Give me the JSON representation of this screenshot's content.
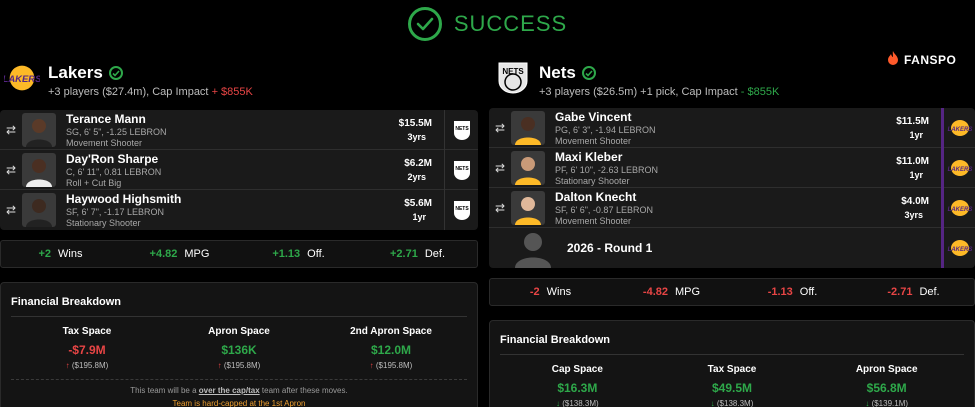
{
  "banner": {
    "title": "SUCCESS",
    "color": "#2ea84a"
  },
  "brand": {
    "name": "FANSPO"
  },
  "left": {
    "team": "Lakers",
    "logo_text": "LAKERS",
    "summary_prefix": "+3 players ($27.4m), Cap Impact",
    "summary_value": "+ $855K",
    "players": [
      {
        "name": "Terance Mann",
        "line": "SG, 6' 5\", -1.25 LEBRON",
        "role": "Movement Shooter",
        "amount": "$15.5M",
        "years": "3yrs"
      },
      {
        "name": "Day'Ron Sharpe",
        "line": "C, 6' 11\", 0.81 LEBRON",
        "role": "Roll + Cut Big",
        "amount": "$6.2M",
        "years": "2yrs"
      },
      {
        "name": "Haywood Highsmith",
        "line": "SF, 6' 7\", -1.17 LEBRON",
        "role": "Stationary Shooter",
        "amount": "$5.6M",
        "years": "1yr"
      }
    ],
    "stats": [
      {
        "value": "+2",
        "label": "Wins"
      },
      {
        "value": "+4.82",
        "label": "MPG"
      },
      {
        "value": "+1.13",
        "label": "Off."
      },
      {
        "value": "+2.71",
        "label": "Def."
      }
    ],
    "financial": {
      "title": "Financial Breakdown",
      "items": [
        {
          "label": "Tax Space",
          "value": "-$7.9M",
          "sub": "($195.8M)",
          "dir": "up"
        },
        {
          "label": "Apron Space",
          "value": "$136K",
          "sub": "($195.8M)",
          "dir": "up"
        },
        {
          "label": "2nd Apron Space",
          "value": "$12.0M",
          "sub": "($195.8M)",
          "dir": "up"
        }
      ],
      "note_pre": "This team will be a",
      "note_bold": "over the cap/tax",
      "note_post": "team after these moves.",
      "warning": "Team is hard-capped at the 1st Apron"
    }
  },
  "right": {
    "team": "Nets",
    "logo_text": "NETS",
    "summary_prefix": "+3 players ($26.5m) +1 pick, Cap Impact",
    "summary_value": "- $855K",
    "players": [
      {
        "name": "Gabe Vincent",
        "line": "PG, 6' 3\", -1.94 LEBRON",
        "role": "Movement Shooter",
        "amount": "$11.5M",
        "years": "1yr"
      },
      {
        "name": "Maxi Kleber",
        "line": "PF, 6' 10\", -2.63 LEBRON",
        "role": "Stationary Shooter",
        "amount": "$11.0M",
        "years": "1yr"
      },
      {
        "name": "Dalton Knecht",
        "line": "SF, 6' 6\", -0.87 LEBRON",
        "role": "Movement Shooter",
        "amount": "$4.0M",
        "years": "3yrs"
      }
    ],
    "pick": {
      "name": "2026 - Round 1"
    },
    "stats": [
      {
        "value": "-2",
        "label": "Wins"
      },
      {
        "value": "-4.82",
        "label": "MPG"
      },
      {
        "value": "-1.13",
        "label": "Off."
      },
      {
        "value": "-2.71",
        "label": "Def."
      }
    ],
    "financial": {
      "title": "Financial Breakdown",
      "items": [
        {
          "label": "Cap Space",
          "value": "$16.3M",
          "sub": "($138.3M)",
          "dir": "down"
        },
        {
          "label": "Tax Space",
          "value": "$49.5M",
          "sub": "($138.3M)",
          "dir": "down"
        },
        {
          "label": "Apron Space",
          "value": "$56.8M",
          "sub": "($139.1M)",
          "dir": "down"
        }
      ]
    }
  },
  "colors": {
    "positive": "#2ea84a",
    "negative": "#e84545",
    "warning": "#f0a030",
    "lakers_purple": "#552583",
    "lakers_gold": "#fdb927"
  },
  "icons": [
    "check-circle-icon",
    "fire-icon",
    "swap-icon",
    "arrow-up-icon",
    "arrow-down-icon"
  ]
}
